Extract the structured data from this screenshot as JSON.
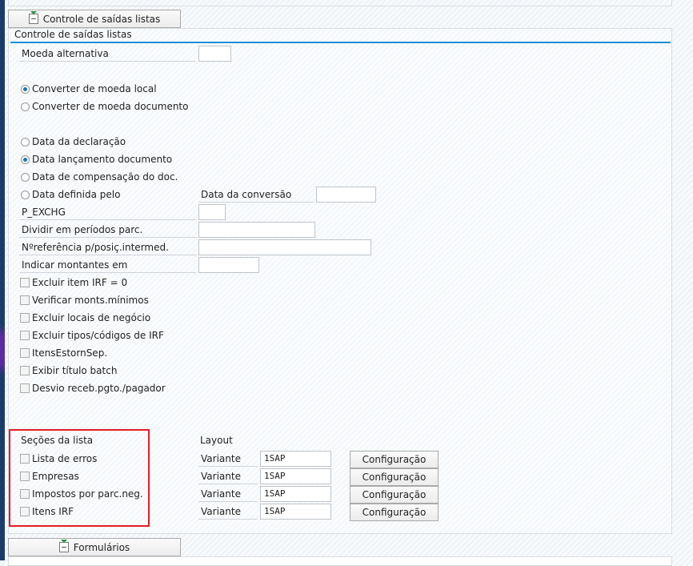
{
  "section_button": "Controle de saídas listas",
  "panel_title": "Controle de saídas listas",
  "fields": {
    "moeda_alternativa": "Moeda alternativa",
    "data_conversao": "Data da conversão",
    "p_exchg": "P_EXCHG",
    "dividir": "Dividir em períodos parc.",
    "nref": "Nºreferência p/posiç.intermed.",
    "indicar": "Indicar montantes em"
  },
  "currency_radios": [
    {
      "label": "Converter de moeda local",
      "checked": true
    },
    {
      "label": "Converter de moeda documento",
      "checked": false
    }
  ],
  "date_radios": [
    {
      "label": "Data da declaração",
      "checked": false
    },
    {
      "label": "Data lançamento documento",
      "checked": true
    },
    {
      "label": "Data de compensação do doc.",
      "checked": false
    },
    {
      "label": "Data definida pelo",
      "checked": false
    }
  ],
  "checkboxes": [
    "Excluir item IRF = 0",
    "Verificar monts.mínimos",
    "Excluir locais de negócio",
    "Excluir tipos/códigos de IRF",
    "ItensEstornSep.",
    "Exibir título batch",
    "Desvio receb.pgto./pagador"
  ],
  "sections": {
    "title": "Seções da lista",
    "items": [
      "Lista de erros",
      "Empresas",
      "Impostos por parc.neg.",
      "Itens IRF"
    ]
  },
  "layout": {
    "title": "Layout",
    "variant_label": "Variante",
    "rows": [
      {
        "value": "1SAP",
        "button": "Configuração"
      },
      {
        "value": "1SAP",
        "button": "Configuração"
      },
      {
        "value": "1SAP",
        "button": "Configuração"
      },
      {
        "value": "1SAP",
        "button": "Configuração"
      }
    ]
  },
  "forms_button": "Formulários"
}
